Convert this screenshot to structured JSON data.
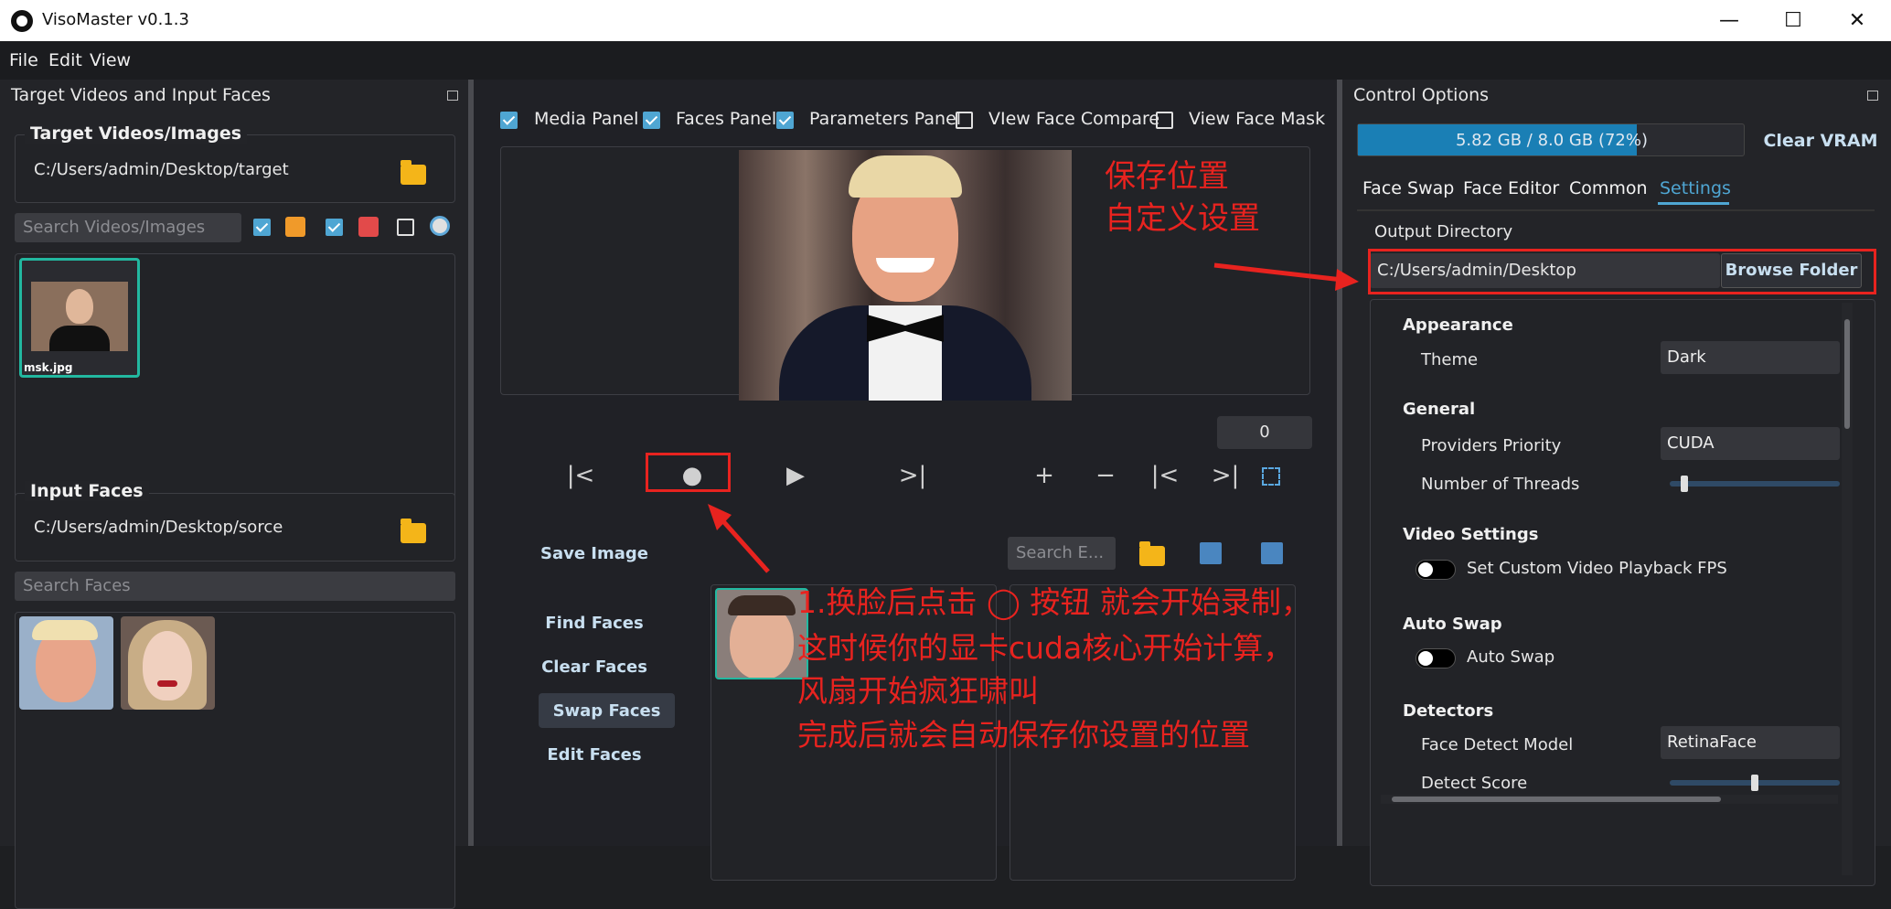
{
  "window": {
    "title": "VisoMaster v0.1.3"
  },
  "menu": [
    "File",
    "Edit",
    "View"
  ],
  "left_panel": {
    "title": "Target Videos and Input Faces",
    "targets": {
      "title": "Target Videos/Images",
      "path": "C:/Users/admin/Desktop/target",
      "search_placeholder": "Search Videos/Images",
      "items": [
        {
          "label": "msk.jpg"
        }
      ]
    },
    "inputs": {
      "title": "Input Faces",
      "path": "C:/Users/admin/Desktop/sorce",
      "search_placeholder": "Search Faces"
    }
  },
  "center": {
    "checks": [
      {
        "label": "Media Panel",
        "checked": true
      },
      {
        "label": "Faces Panel",
        "checked": true
      },
      {
        "label": "Parameters Panel",
        "checked": true
      },
      {
        "label": "VIew Face Compare",
        "checked": false
      },
      {
        "label": "View Face Mask",
        "checked": false
      }
    ],
    "frame_number": "0",
    "buttons": {
      "save_image": "Save Image",
      "find_faces": "Find Faces",
      "clear_faces": "Clear Faces",
      "swap_faces": "Swap Faces",
      "edit_faces": "Edit Faces"
    },
    "face_search_placeholder": "Search E...",
    "controls": {
      "prev": "|<",
      "record": "●",
      "play": "▶",
      "next": ">|",
      "plus": "+",
      "minus": "−",
      "prev_mark": "|<",
      "next_mark": ">|"
    }
  },
  "right_panel": {
    "title": "Control Options",
    "vram": {
      "text": "5.82 GB / 8.0 GB (72%)",
      "fraction": 0.72
    },
    "clear_vram": "Clear VRAM",
    "tabs": [
      "Face Swap",
      "Face Editor",
      "Common",
      "Settings"
    ],
    "active_tab": "Settings",
    "output_dir_label": "Output Directory",
    "output_dir": "C:/Users/admin/Desktop",
    "browse_folder": "Browse Folder",
    "sections": {
      "appearance": {
        "title": "Appearance",
        "theme_label": "Theme",
        "theme_value": "Dark"
      },
      "general": {
        "title": "General",
        "providers_label": "Providers Priority",
        "providers_value": "CUDA",
        "threads_label": "Number of Threads",
        "threads_level": 0.08
      },
      "video": {
        "title": "Video Settings",
        "fps_label": "Set Custom Video Playback FPS"
      },
      "autoswap": {
        "title": "Auto Swap",
        "label": "Auto Swap"
      },
      "detectors": {
        "title": "Detectors",
        "model_label": "Face Detect Model",
        "model_value": "RetinaFace",
        "score_label": "Detect Score",
        "score_level": 0.5
      }
    }
  },
  "annotations": {
    "save_note_1": "保存位置",
    "save_note_2": "自定义设置",
    "record_note": [
      "1.换脸后点击 ◯ 按钮 就会开始录制，",
      "这时候你的显卡cuda核心开始计算，",
      "风扇开始疯狂啸叫",
      "完成后就会自动保存你设置的位置"
    ]
  },
  "colors": {
    "accent": "#4fa6d3",
    "annotation": "#e8231f",
    "vram_bar": "#1a7fb5"
  }
}
